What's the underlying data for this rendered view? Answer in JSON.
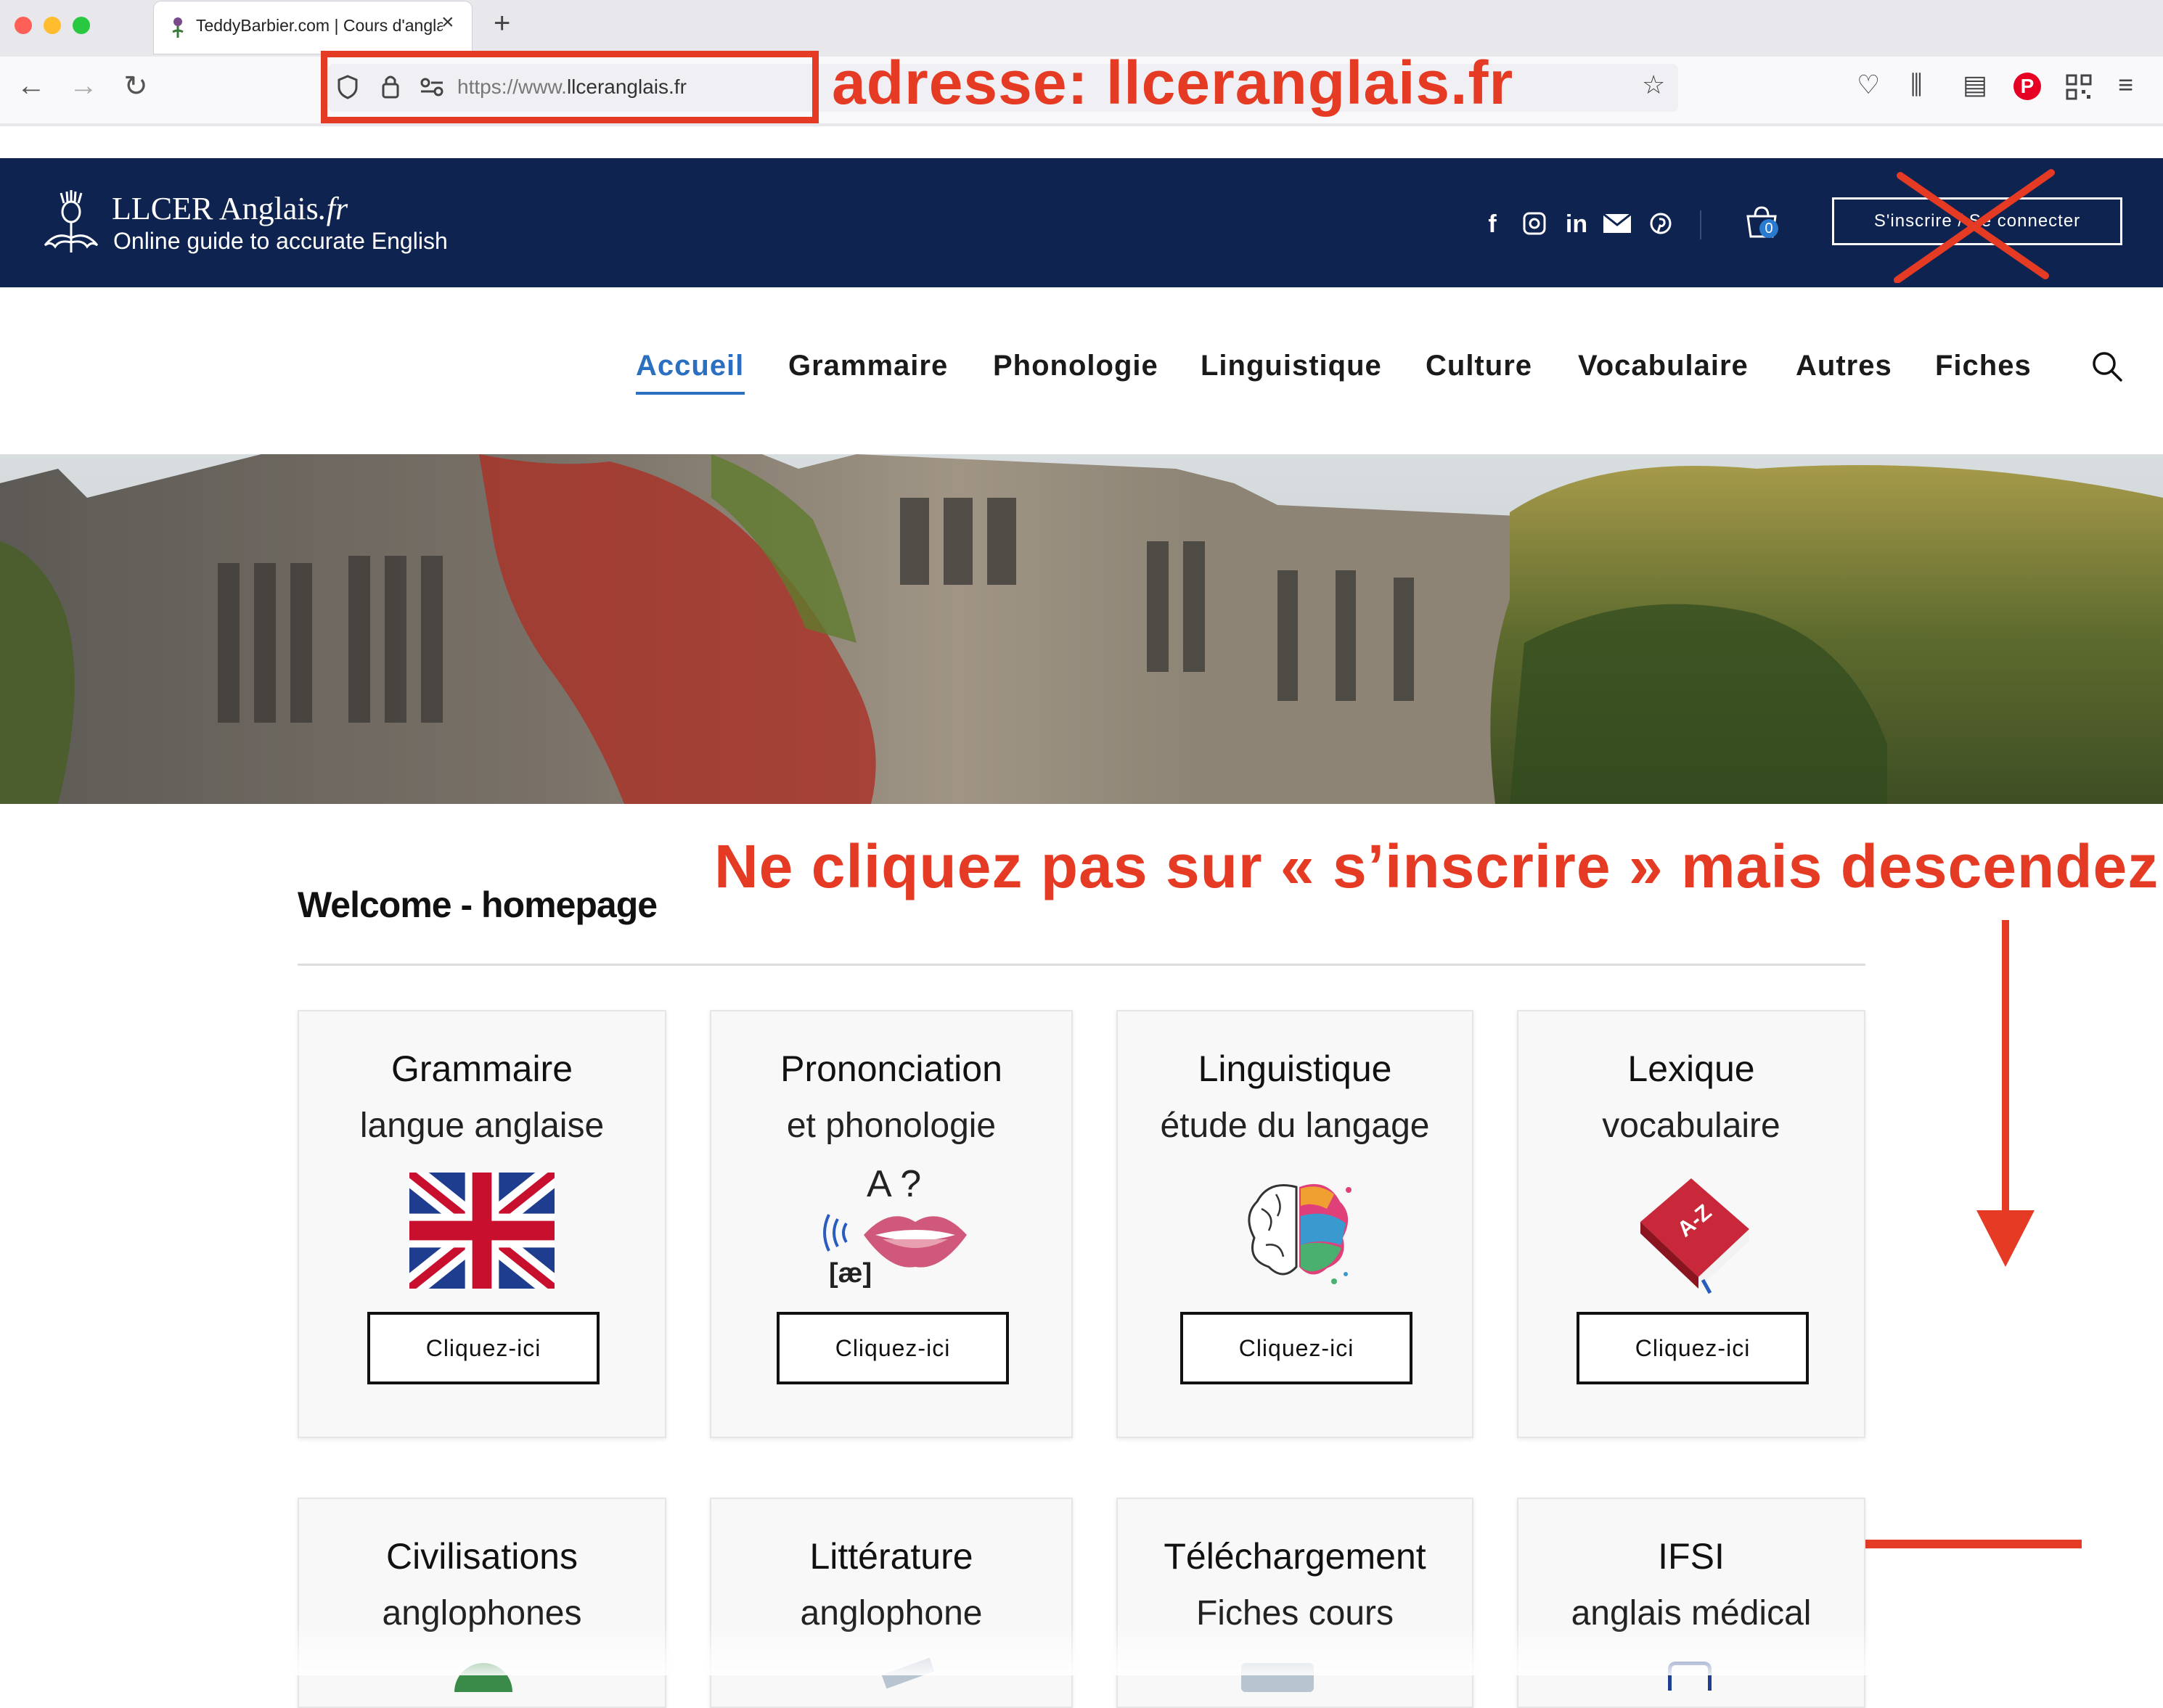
{
  "browser": {
    "tab_title": "TeddyBarbier.com | Cours d'anglais",
    "url_prefix": "https://www.",
    "url_domain": "llceranglais.fr",
    "new_tab_symbol": "+",
    "close_symbol": "×"
  },
  "annotations": {
    "url_note": "adresse: llceranglais.fr",
    "scroll_note": "Ne cliquez pas sur « s’inscrire » mais descendez"
  },
  "site": {
    "logo_name": "LLCER Anglais",
    "logo_suffix": ".fr",
    "logo_tagline": "Online guide to accurate English",
    "social": [
      "f",
      "in"
    ],
    "cart_count": "0",
    "login_label": "S'inscrire / Se connecter"
  },
  "menu": {
    "items": [
      "Accueil",
      "Grammaire",
      "Phonologie",
      "Linguistique",
      "Culture",
      "Vocabulaire",
      "Autres",
      "Fiches"
    ],
    "active": "Accueil"
  },
  "content": {
    "welcome_title": "Welcome - homepage",
    "cards": [
      {
        "title": "Grammaire",
        "subtitle": "langue anglaise",
        "button": "Cliquez-ici",
        "icon": "uk-flag-icon"
      },
      {
        "title": "Prononciation",
        "subtitle": "et phonologie",
        "button": "Cliquez-ici",
        "icon": "mouth-icon",
        "icon_text": "A ?",
        "phonetic": "[æ]"
      },
      {
        "title": "Linguistique",
        "subtitle": "étude du langage",
        "button": "Cliquez-ici",
        "icon": "brain-icon"
      },
      {
        "title": "Lexique",
        "subtitle": "vocabulaire",
        "button": "Cliquez-ici",
        "icon": "book-icon",
        "icon_text": "A-Z"
      },
      {
        "title": "Civilisations",
        "subtitle": "anglophones"
      },
      {
        "title": "Littérature",
        "subtitle": "anglophone"
      },
      {
        "title": "Téléchargement",
        "subtitle": "Fiches cours"
      },
      {
        "title": "IFSI",
        "subtitle": "anglais médical"
      }
    ]
  },
  "colors": {
    "header_bg": "#0f2350",
    "annotation_red": "#e53a24",
    "active_link": "#2a6fc0"
  }
}
